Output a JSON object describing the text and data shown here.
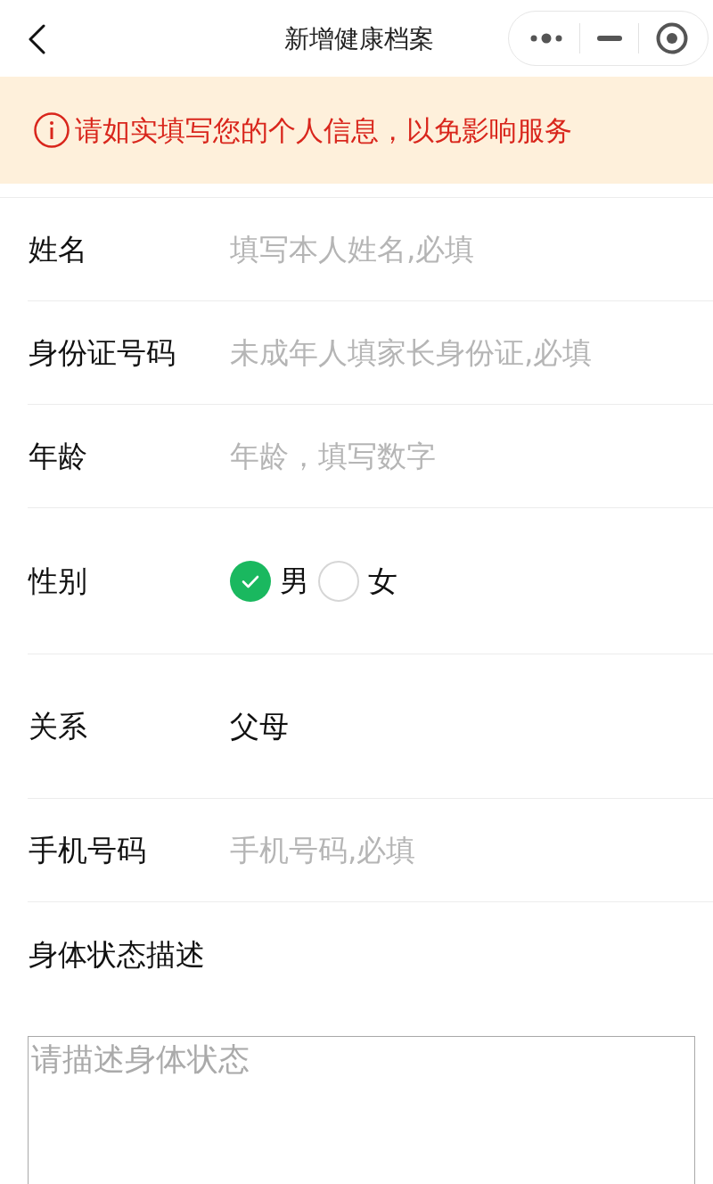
{
  "nav_bar": {
    "title": "新增健康档案"
  },
  "notice": {
    "text": "请如实填写您的个人信息，以免影响服务"
  },
  "form": {
    "fields": [
      {
        "kind": "text",
        "label": "姓名",
        "placeholder": "填写本人姓名,必填"
      },
      {
        "kind": "text",
        "label": "身份证号码",
        "placeholder": "未成年人填家长身份证,必填"
      },
      {
        "kind": "text",
        "label": "年龄",
        "placeholder": "年龄，填写数字"
      },
      {
        "kind": "radio",
        "label": "性别",
        "options": [
          {
            "label": "男",
            "selected": true
          },
          {
            "label": "女",
            "selected": false
          }
        ]
      },
      {
        "kind": "picker",
        "label": "关系",
        "value": "父母"
      },
      {
        "kind": "text",
        "label": "手机号码",
        "placeholder": "手机号码,必填"
      },
      {
        "kind": "textarea",
        "label": "身体状态描述",
        "placeholder": "请描述身体状态"
      }
    ]
  }
}
